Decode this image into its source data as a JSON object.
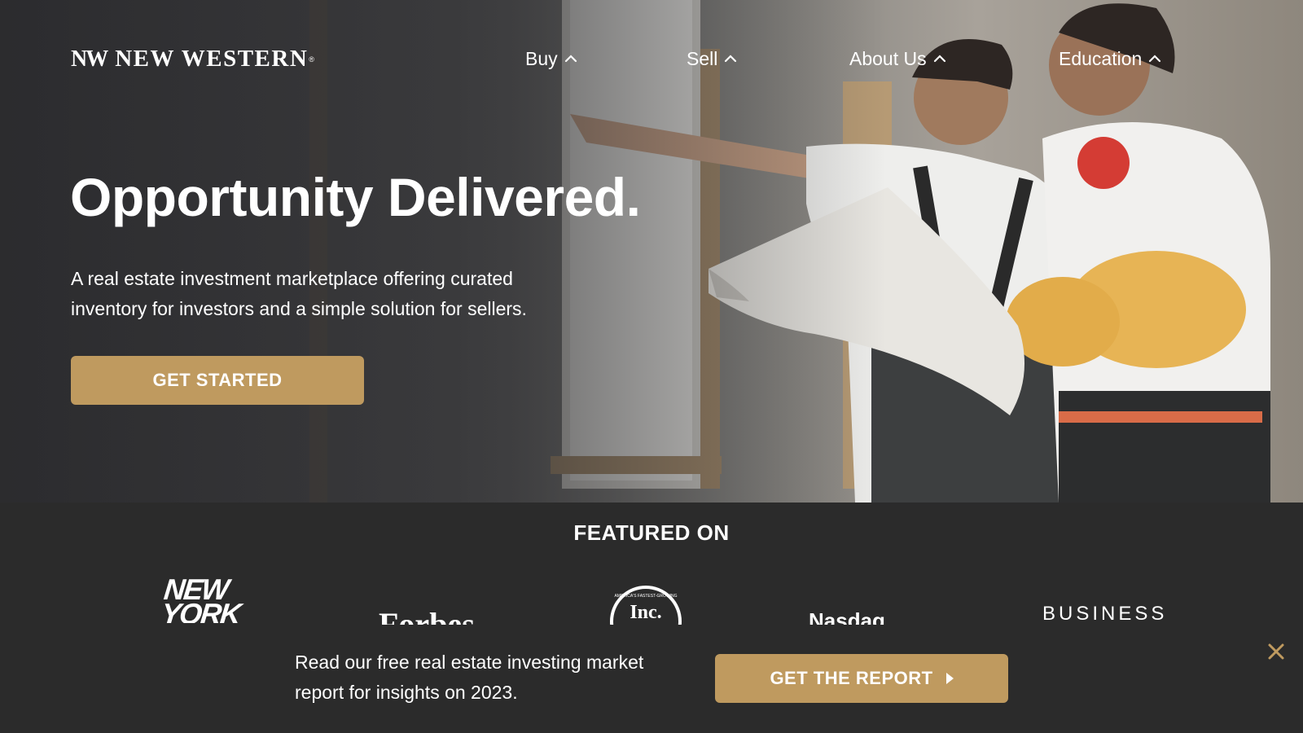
{
  "header": {
    "logo_mark": "NW",
    "logo_text": "NEW WESTERN",
    "logo_reg": "®",
    "nav": [
      {
        "label": "Buy",
        "icon": "chevron-up-icon"
      },
      {
        "label": "Sell",
        "icon": "chevron-up-icon"
      },
      {
        "label": "About Us",
        "icon": "chevron-up-icon"
      },
      {
        "label": "Education",
        "icon": "chevron-up-icon"
      }
    ]
  },
  "hero": {
    "headline": "Opportunity Delivered.",
    "subhead": "A real estate investment marketplace offering curated inventory for investors and a simple solution for sellers.",
    "cta_label": "GET STARTED",
    "image": "two-contractors-with-blueprint"
  },
  "featured": {
    "title": "FEATURED ON",
    "logos": [
      {
        "name": "new-york-post-logo",
        "text": "NEW YORK"
      },
      {
        "name": "forbes-logo",
        "text": "Forbes"
      },
      {
        "name": "inc-logo",
        "text": "Inc.",
        "ring_text": "AMERICA'S FASTEST-GROWING"
      },
      {
        "name": "nasdaq-logo",
        "text": "Nasdaq"
      },
      {
        "name": "business-insider-logo",
        "text": "BUSINESS"
      }
    ]
  },
  "banner": {
    "text": "Read our free real estate investing market report for insights on 2023.",
    "cta_label": "GET THE REPORT",
    "cta_icon": "play-icon",
    "close_icon": "close-icon"
  },
  "colors": {
    "accent_gold": "#bf9a5f",
    "dark_bg": "#2b2b2b",
    "text": "#ffffff"
  }
}
